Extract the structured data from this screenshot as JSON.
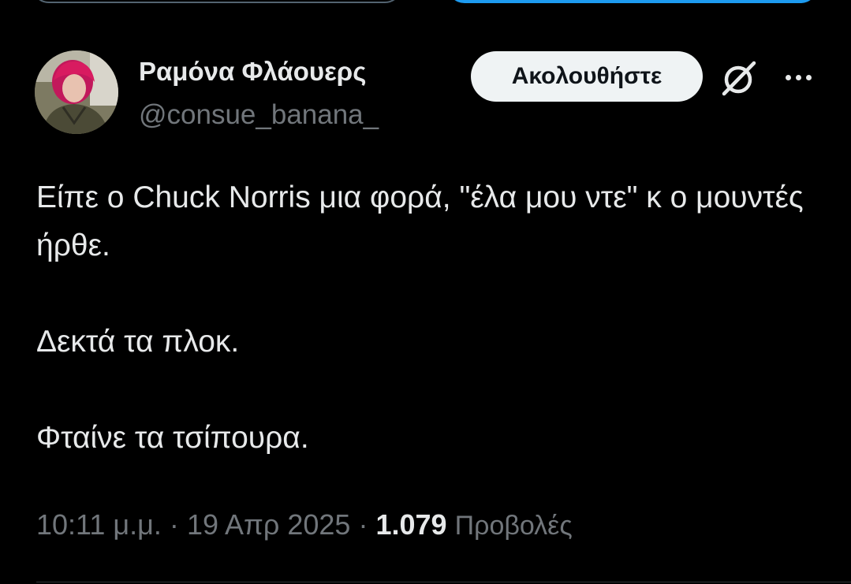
{
  "author": {
    "display_name": "Ραμόνα Φλάουερς",
    "handle": "@consue_banana_",
    "avatar_icon": "avatar-photo"
  },
  "actions": {
    "follow_label": "Ακολουθήστε",
    "grok_icon": "grok-icon",
    "more_icon": "more-horizontal-icon"
  },
  "tweet": {
    "lines": [
      "Είπε ο Chuck Norris μια φορά, \"έλα μου ντε\" κ ο μουντές ήρθε.",
      "Δεκτά τα πλοκ.",
      "Φταίνε τα τσίπουρα."
    ]
  },
  "meta": {
    "time": "10:11 μ.μ.",
    "separator": "·",
    "date": "19 Απρ 2025",
    "views_count": "1.079",
    "views_label": "Προβολές"
  },
  "colors": {
    "background": "#000000",
    "text_primary": "#e7e9ea",
    "text_secondary": "#71767b",
    "accent": "#1d9bf0",
    "follow_bg": "#eff3f4"
  }
}
